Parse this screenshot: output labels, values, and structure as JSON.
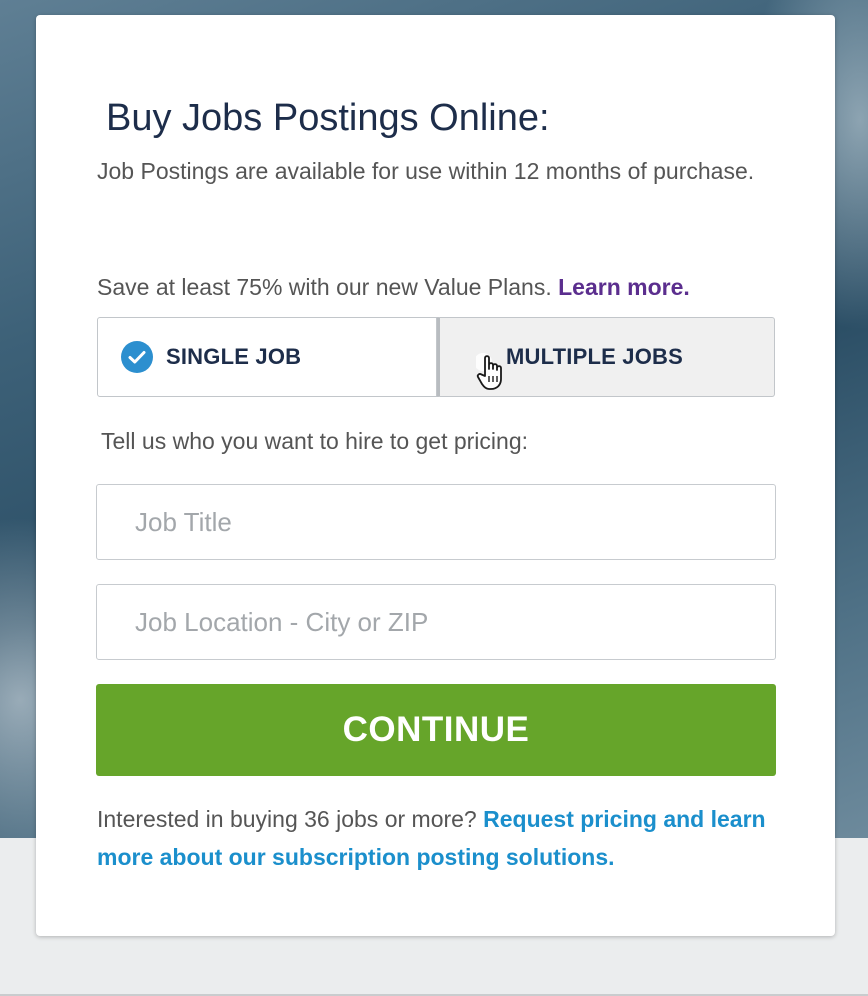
{
  "page": {
    "title": "Buy Jobs Postings Online:",
    "intro": "Job Postings are available for use within 12 months of purchase.",
    "save_text": "Save at least 75% with our new Value Plans. ",
    "learn_more_link": "Learn more."
  },
  "plan_toggle": {
    "options": [
      {
        "label": "SINGLE JOB",
        "selected": true,
        "icon": "checkmark-icon"
      },
      {
        "label": "MULTIPLE JOBS",
        "selected": false,
        "icon": "radio-empty-icon"
      }
    ]
  },
  "form": {
    "prompt": "Tell us who you want to hire to get pricing:",
    "job_title_placeholder": "Job Title",
    "job_title_value": "",
    "job_location_placeholder": "Job Location - City or ZIP",
    "job_location_value": "",
    "continue_label": "CONTINUE"
  },
  "footer": {
    "text": "Interested in buying 36 jobs or more? ",
    "link": "Request pricing and learn more about our subscription posting solutions."
  },
  "colors": {
    "title": "#1d2d4a",
    "body_text": "#555555",
    "learn_more_link": "#5b2e8e",
    "check_circle": "#2c8fcf",
    "continue_button": "#66a52a",
    "footer_link": "#1b8fcc"
  },
  "cursor": "hand-pointer-icon"
}
